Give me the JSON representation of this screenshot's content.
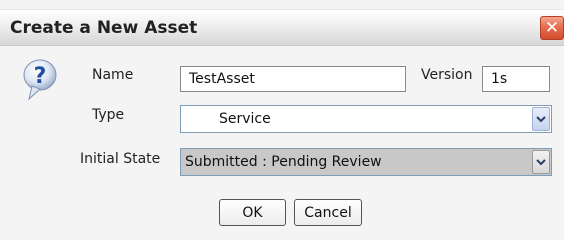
{
  "dialog": {
    "title": "Create a New Asset",
    "close_icon": "close-x-icon",
    "help_icon": "question-icon"
  },
  "form": {
    "name_label": "Name",
    "name_value": "TestAsset",
    "version_label": "Version",
    "version_value": "1s",
    "type_label": "Type",
    "type_value": "Service",
    "state_label": "Initial State",
    "state_value": "Submitted : Pending Review"
  },
  "buttons": {
    "ok_label": "OK",
    "cancel_label": "Cancel"
  },
  "colors": {
    "close_button": "#e36a4b",
    "state_select_bg": "#c8c8c8"
  }
}
